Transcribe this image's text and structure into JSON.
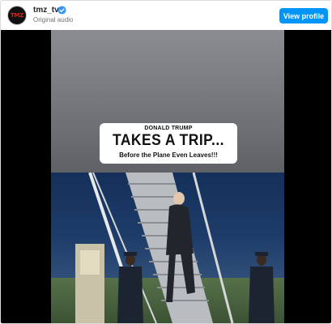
{
  "header": {
    "username": "tmz_tv",
    "avatar_text": "TMZ",
    "subtitle": "Original audio",
    "view_profile_label": "View profile"
  },
  "video": {
    "caption_line1": "DONALD TRUMP",
    "caption_line2": "TAKES A TRIP...",
    "caption_line3": "Before the Plane Even Leaves!!!"
  },
  "colors": {
    "accent": "#0095f6",
    "verified": "#3897f0",
    "brand": "#e0201b"
  }
}
